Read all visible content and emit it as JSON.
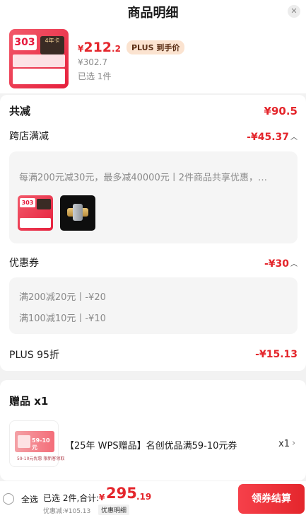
{
  "header": {
    "title": "商品明细",
    "close_glyph": "✕"
  },
  "product": {
    "thumb_text_1": "303",
    "thumb_text_2": "4年卡",
    "currency": "¥",
    "price_int": "212",
    "price_dec": ".2",
    "plus_tag": "PLUS 到手价",
    "original_price": "¥302.7",
    "selected": "已选 1件"
  },
  "summary": {
    "total_label": "共减",
    "total_value": "¥90.5",
    "cross_store_label": "跨店满减",
    "cross_store_value": "-¥45.37",
    "cross_store_desc": "每满200元减30元，最多减40000元丨2件商品共享优惠，…",
    "coupon_label": "优惠券",
    "coupon_value": "-¥30",
    "coupons": [
      {
        "text": "满200减20元丨-¥20"
      },
      {
        "text": "满100减10元丨-¥10"
      }
    ],
    "plus_label": "PLUS 95折",
    "plus_value": "-¥15.13"
  },
  "gift": {
    "title": "赠品 x1",
    "image_text": "59-10元",
    "image_caption": "59-10元优惠 限新客领取",
    "name": "【25年 WPS赠品】名创优品满59-10元券",
    "qty": "x1"
  },
  "bottom_bar": {
    "select_all": "全选",
    "chosen": "已选 2件,合计:",
    "currency": "¥",
    "total_int": "295",
    "total_dec": ".19",
    "saved": "优惠减:¥105.13",
    "detail": "优惠明细",
    "checkout": "领券结算"
  },
  "colors": {
    "accent_red": "#e4262c",
    "plus_tag_bg": "#fbe3d0",
    "muted_text": "#8a8a8a"
  },
  "icons": {
    "close": "close-icon",
    "chevron_up": "chevron-up-icon",
    "chevron_right": "chevron-right-icon",
    "radio": "radio-circle-icon"
  }
}
